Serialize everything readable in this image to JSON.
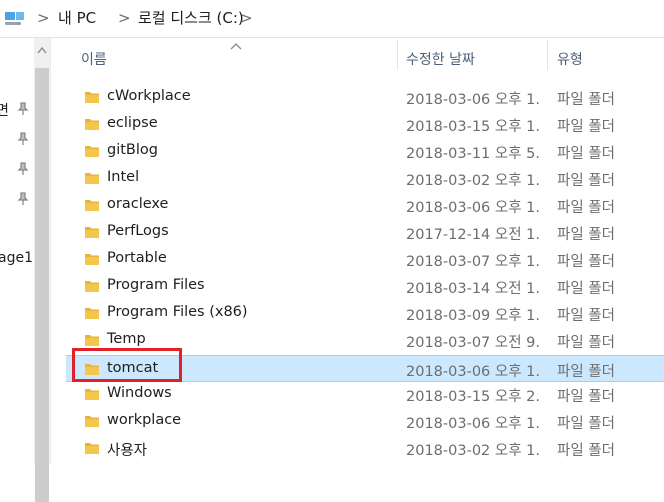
{
  "address": {
    "crumbs": [
      "내 PC",
      "로컬 디스크 (C:)"
    ]
  },
  "nav": {
    "partial_labels": [
      "면",
      "age1"
    ]
  },
  "columns": {
    "name": "이름",
    "date": "수정한 날짜",
    "type": "유형"
  },
  "files": [
    {
      "name": "cWorkplace",
      "date": "2018-03-06 오후 1...",
      "type": "파일 폴더"
    },
    {
      "name": "eclipse",
      "date": "2018-03-15 오후 1...",
      "type": "파일 폴더"
    },
    {
      "name": "gitBlog",
      "date": "2018-03-11 오후 5...",
      "type": "파일 폴더"
    },
    {
      "name": "Intel",
      "date": "2018-03-02 오후 1...",
      "type": "파일 폴더"
    },
    {
      "name": "oraclexe",
      "date": "2018-03-06 오후 1...",
      "type": "파일 폴더"
    },
    {
      "name": "PerfLogs",
      "date": "2017-12-14 오전 1...",
      "type": "파일 폴더"
    },
    {
      "name": "Portable",
      "date": "2018-03-07 오후 1...",
      "type": "파일 폴더"
    },
    {
      "name": "Program Files",
      "date": "2018-03-14 오전 1...",
      "type": "파일 폴더"
    },
    {
      "name": "Program Files (x86)",
      "date": "2018-03-09 오후 1...",
      "type": "파일 폴더"
    },
    {
      "name": "Temp",
      "date": "2018-03-07 오전 9...",
      "type": "파일 폴더"
    },
    {
      "name": "tomcat",
      "date": "2018-03-06 오후 1...",
      "type": "파일 폴더",
      "selected": true
    },
    {
      "name": "Windows",
      "date": "2018-03-15 오후 2...",
      "type": "파일 폴더"
    },
    {
      "name": "workplace",
      "date": "2018-03-06 오후 1...",
      "type": "파일 폴더"
    },
    {
      "name": "사용자",
      "date": "2018-03-02 오후 1...",
      "type": "파일 폴더"
    }
  ],
  "colors": {
    "selection_bg": "#cce8ff",
    "highlight_border": "#e2222a",
    "folder": "#f3c64c"
  }
}
